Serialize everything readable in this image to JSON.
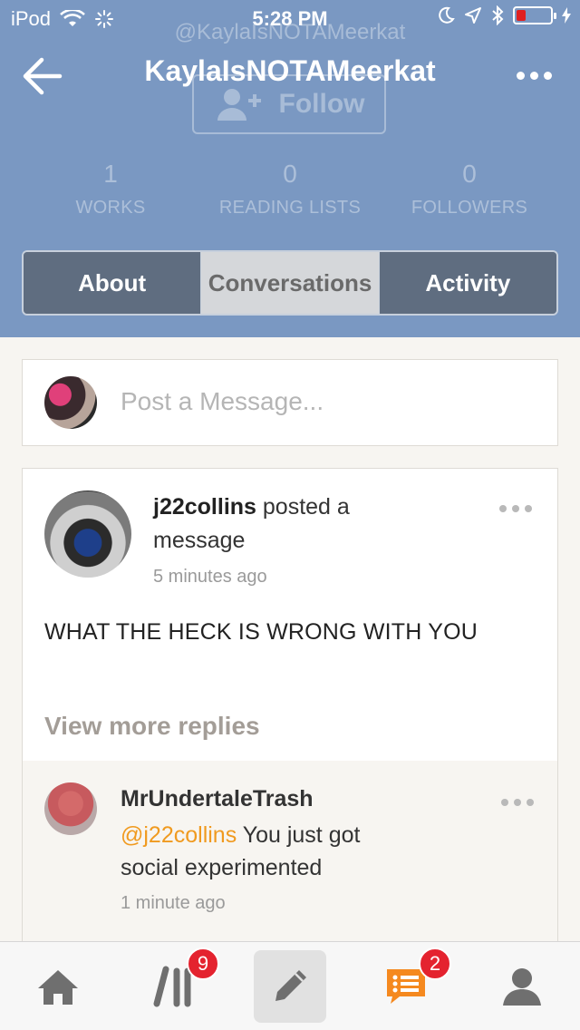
{
  "status_bar": {
    "carrier": "iPod",
    "time": "5:28 PM"
  },
  "profile": {
    "handle": "@KaylaIsNOTAMeerkat",
    "username": "KaylaIsNOTAMeerkat",
    "follow_label": "Follow",
    "stats": [
      {
        "value": "1",
        "label": "WORKS"
      },
      {
        "value": "0",
        "label": "READING LISTS"
      },
      {
        "value": "0",
        "label": "FOLLOWERS"
      }
    ]
  },
  "tabs": [
    {
      "label": "About",
      "active": false
    },
    {
      "label": "Conversations",
      "active": true
    },
    {
      "label": "Activity",
      "active": false
    }
  ],
  "composer": {
    "placeholder": "Post a Message..."
  },
  "post": {
    "author": "j22collins",
    "action": " posted a message",
    "time": "5 minutes ago",
    "body": "WHAT THE HECK IS WRONG WITH YOU",
    "view_more_label": "View more replies"
  },
  "reply": {
    "author": "MrUndertaleTrash",
    "mention": "@j22collins",
    "text": " You just got social experimented",
    "time": "1 minute ago"
  },
  "tabbar": {
    "library_badge": "9",
    "messages_badge": "2"
  },
  "colors": {
    "header_bg": "#7a98c2",
    "accent_orange": "#f5891f",
    "badge_red": "#e4232f"
  }
}
